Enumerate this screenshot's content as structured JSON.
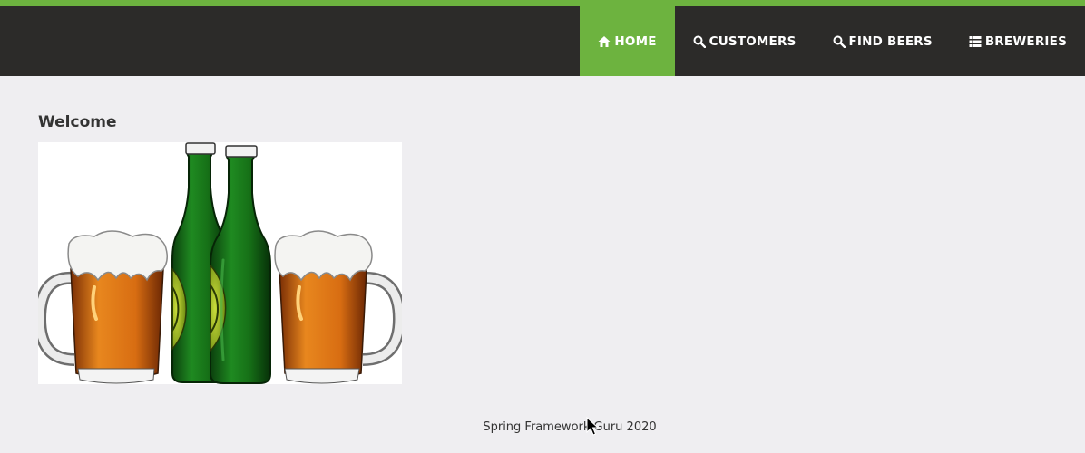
{
  "nav": {
    "items": [
      {
        "label": "HOME",
        "icon": "home-icon",
        "active": true
      },
      {
        "label": "CUSTOMERS",
        "icon": "search-icon",
        "active": false
      },
      {
        "label": "FIND BEERS",
        "icon": "search-icon",
        "active": false
      },
      {
        "label": "BREWERIES",
        "icon": "list-icon",
        "active": false
      }
    ]
  },
  "main": {
    "heading": "Welcome"
  },
  "footer": {
    "text": "Spring Framework Guru 2020"
  },
  "colors": {
    "accent": "#6db33f",
    "navbar": "#2c2b29",
    "page_bg": "#efeef1"
  }
}
